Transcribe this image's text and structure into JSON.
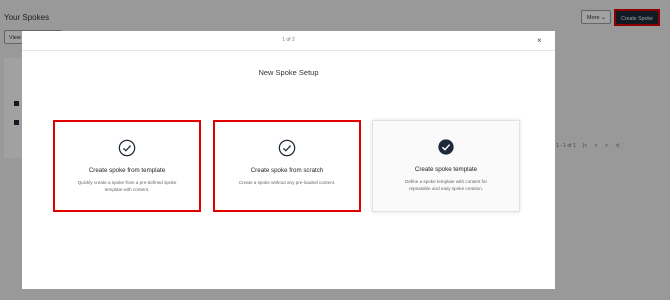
{
  "page": {
    "title": "Your Spokes",
    "view_label": "View"
  },
  "header": {
    "more_label": "More",
    "create_label": "Create Spoke"
  },
  "pager": {
    "range": "1 - 1 of 1"
  },
  "modal": {
    "step": "1 of 2",
    "title": "New Spoke Setup",
    "close": "×",
    "cards": [
      {
        "title": "Create spoke from template",
        "desc": "Quickly create a spoke from a pre-defined spoke template with content."
      },
      {
        "title": "Create spoke from scratch",
        "desc": "Create a spoke without any pre-loaded content."
      },
      {
        "title": "Create spoke template",
        "desc": "Define a spoke template with content for repeatable and easy spoke creation."
      }
    ]
  },
  "colors": {
    "accent": "#1e2a3a",
    "highlight": "#e00000"
  },
  "icons": {
    "check_outline": "check-circle-outline-icon",
    "check_filled": "check-circle-filled-icon"
  }
}
